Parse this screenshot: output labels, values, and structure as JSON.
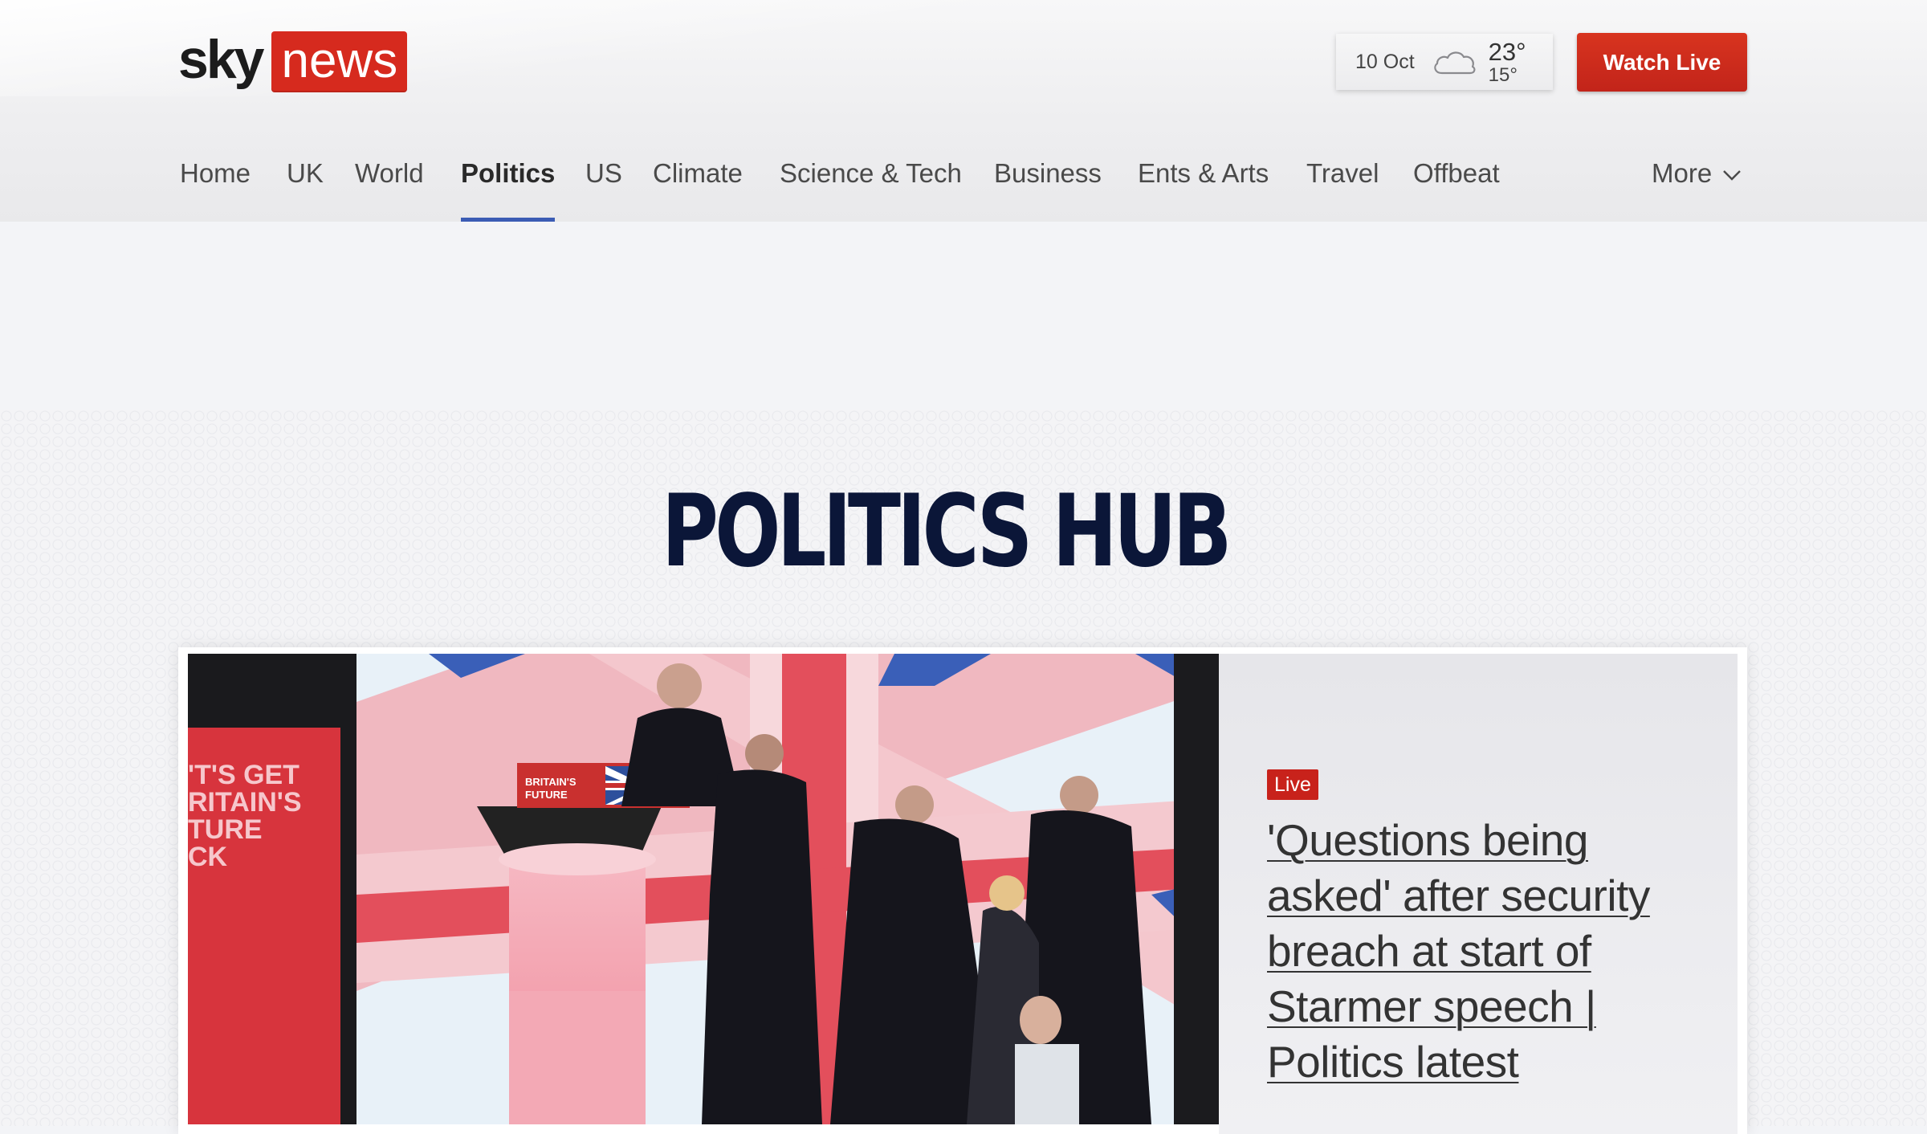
{
  "header": {
    "logo": {
      "sky": "sky",
      "news": "news"
    },
    "weather": {
      "date": "10 Oct",
      "icon": "cloud-icon",
      "high": "23°",
      "low": "15°"
    },
    "watch_live_label": "Watch Live"
  },
  "nav": {
    "items": [
      {
        "label": "Home"
      },
      {
        "label": "UK"
      },
      {
        "label": "World"
      },
      {
        "label": "Politics",
        "active": true
      },
      {
        "label": "US"
      },
      {
        "label": "Climate"
      },
      {
        "label": "Science & Tech"
      },
      {
        "label": "Business"
      },
      {
        "label": "Ents & Arts"
      },
      {
        "label": "Travel"
      },
      {
        "label": "Offbeat"
      }
    ],
    "more_label": "More"
  },
  "hub": {
    "title": "POLITICS HUB"
  },
  "story": {
    "image_text": {
      "left_sign": "'T'S GET RITAIN'S TURE CK",
      "podium": "BRITAIN'S FUTURE"
    },
    "badge": "Live",
    "headline": "'Questions being asked' after security breach at start of Starmer speech | Politics latest"
  },
  "colors": {
    "brand_red": "#d62a1e",
    "watch_live_red": "#c8241a",
    "nav_active_underline": "#3b5cb4",
    "hub_title": "#0b1638"
  }
}
